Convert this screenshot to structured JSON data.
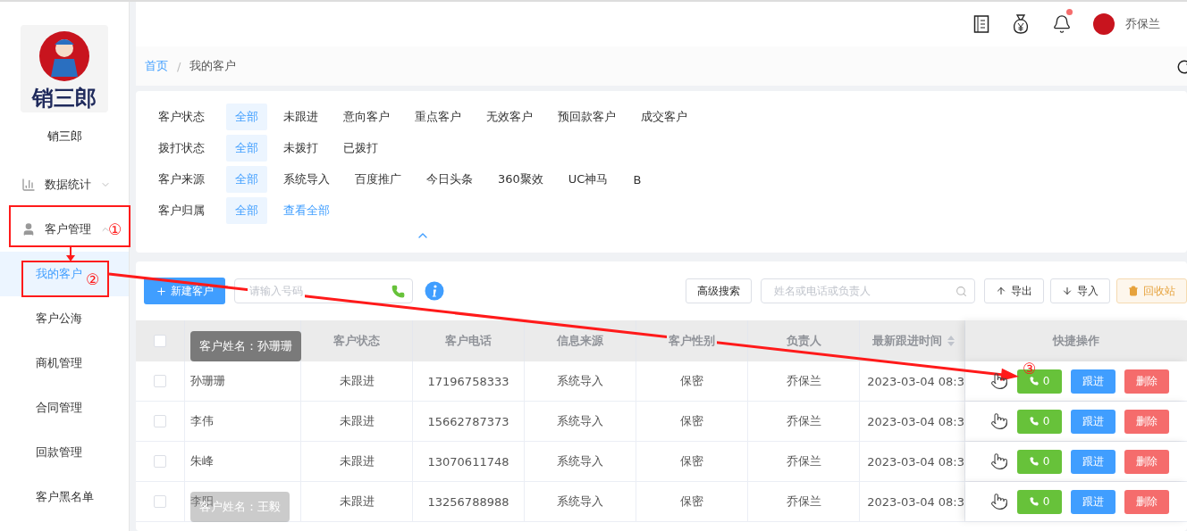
{
  "sidebar": {
    "logo_text": "销三郎",
    "brand": "销三郎",
    "menu": [
      {
        "label": "数据统计",
        "expanded": false
      },
      {
        "label": "客户管理",
        "expanded": true,
        "children": [
          {
            "label": "我的客户",
            "selected": true
          },
          {
            "label": "客户公海",
            "selected": false
          },
          {
            "label": "商机管理",
            "selected": false
          },
          {
            "label": "合同管理",
            "selected": false
          },
          {
            "label": "回款管理",
            "selected": false
          },
          {
            "label": "客户黑名单",
            "selected": false
          }
        ]
      }
    ]
  },
  "topbar": {
    "has_unread": true,
    "user": "乔保兰"
  },
  "breadcrumb": [
    "首页",
    "我的客户"
  ],
  "breadcrumb_separator": "/",
  "filters": [
    {
      "label": "客户状态",
      "options": [
        {
          "label": "全部",
          "selected": true,
          "kind": "option"
        },
        {
          "label": "未跟进",
          "selected": false,
          "kind": "option"
        },
        {
          "label": "意向客户",
          "selected": false,
          "kind": "option"
        },
        {
          "label": "重点客户",
          "selected": false,
          "kind": "option"
        },
        {
          "label": "无效客户",
          "selected": false,
          "kind": "option"
        },
        {
          "label": "预回款客户",
          "selected": false,
          "kind": "option"
        },
        {
          "label": "成交客户",
          "selected": false,
          "kind": "option"
        }
      ]
    },
    {
      "label": "拨打状态",
      "options": [
        {
          "label": "全部",
          "selected": true,
          "kind": "option"
        },
        {
          "label": "未拨打",
          "selected": false,
          "kind": "option"
        },
        {
          "label": "已拨打",
          "selected": false,
          "kind": "option"
        }
      ]
    },
    {
      "label": "客户来源",
      "options": [
        {
          "label": "全部",
          "selected": true,
          "kind": "option"
        },
        {
          "label": "系统导入",
          "selected": false,
          "kind": "option"
        },
        {
          "label": "百度推广",
          "selected": false,
          "kind": "option"
        },
        {
          "label": "今日头条",
          "selected": false,
          "kind": "option"
        },
        {
          "label": "360聚效",
          "selected": false,
          "kind": "option"
        },
        {
          "label": "UC神马",
          "selected": false,
          "kind": "option"
        },
        {
          "label": "B",
          "selected": false,
          "kind": "option"
        }
      ]
    },
    {
      "label": "客户归属",
      "options": [
        {
          "label": "全部",
          "selected": true,
          "kind": "option"
        },
        {
          "label": "查看全部",
          "selected": false,
          "kind": "link"
        }
      ]
    }
  ],
  "toolbar": {
    "new_button": "新建客户",
    "phone_placeholder": "请输入号码",
    "advanced": "高级搜索",
    "search_placeholder": "姓名或电话或负责人",
    "export": "导出",
    "import": "导入",
    "recycle": "回收站"
  },
  "table": {
    "all_checked": false,
    "columns": [
      "客户状态",
      "客户电话",
      "信息来源",
      "客户性别",
      "负责人",
      "最新跟进时间"
    ],
    "action_column": "快捷操作",
    "rows": [
      {
        "checked": false,
        "name": "孙珊珊",
        "status": "未跟进",
        "phone": "17196758333",
        "source": "系统导入",
        "gender": "保密",
        "owner": "乔保兰",
        "time": "2023-03-04 08:3",
        "calls": "0",
        "follow": "跟进",
        "delete": "删除"
      },
      {
        "checked": false,
        "name": "李伟",
        "status": "未跟进",
        "phone": "15662787373",
        "source": "系统导入",
        "gender": "保密",
        "owner": "乔保兰",
        "time": "2023-03-04 08:3",
        "calls": "0",
        "follow": "跟进",
        "delete": "删除"
      },
      {
        "checked": false,
        "name": "朱峰",
        "status": "未跟进",
        "phone": "13070611748",
        "source": "系统导入",
        "gender": "保密",
        "owner": "乔保兰",
        "time": "2023-03-04 08:3",
        "calls": "0",
        "follow": "跟进",
        "delete": "删除"
      },
      {
        "checked": false,
        "name": "李阳",
        "status": "未跟进",
        "phone": "13256788988",
        "source": "系统导入",
        "gender": "保密",
        "owner": "乔保兰",
        "time": "2023-03-04 08:3",
        "calls": "0",
        "follow": "跟进",
        "delete": "删除"
      }
    ]
  },
  "tooltips": [
    {
      "text": "客户姓名：孙珊珊",
      "faded": false
    },
    {
      "text": "客户姓名：王毅",
      "faded": true
    }
  ],
  "annotations": [
    "①",
    "②",
    "③"
  ]
}
